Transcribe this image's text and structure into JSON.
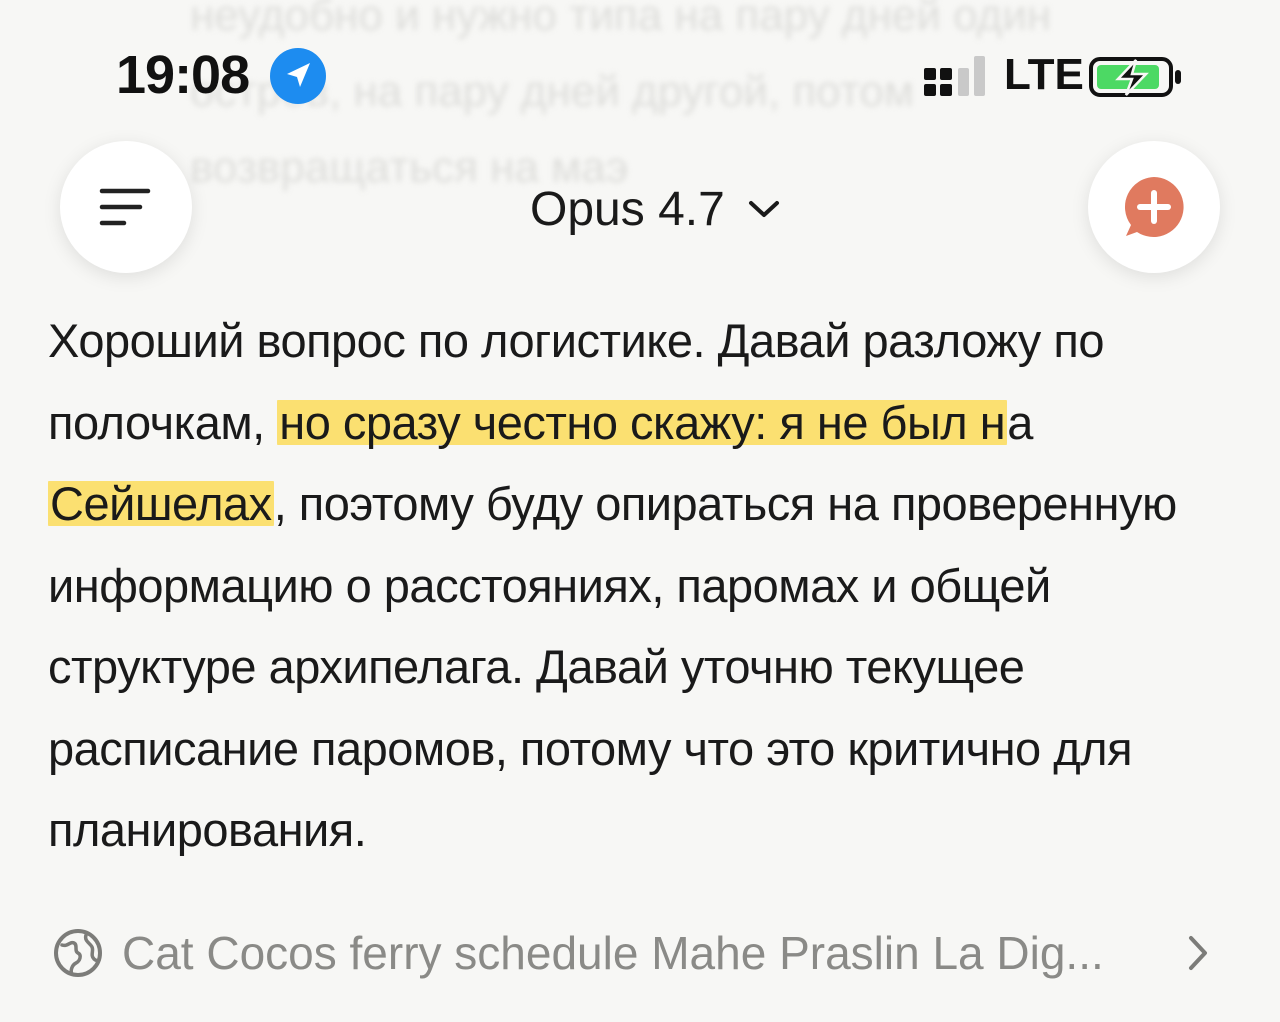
{
  "status_bar": {
    "time": "19:08",
    "network": "LTE"
  },
  "header": {
    "model_label": "Opus 4.7"
  },
  "message": {
    "part1": "Хороший вопрос по логистике. Давай разложу по полочкам, ",
    "highlight1": "но сразу честно скажу: я не был н",
    "part2": "а ",
    "highlight2": "Сейшелах",
    "part3": ", поэтому буду опираться на проверенную информацию о расстояниях, паромах и общей структуре архипелага. Давай уточню текущее расписание паромов, потому что это критично для планирования."
  },
  "search": {
    "query": "Cat Cocos ferry schedule Mahe Praslin La Dig..."
  },
  "colors": {
    "accent_orange": "#e07a5f",
    "highlight_yellow": "#fcda4c",
    "location_blue": "#1d8cf0",
    "battery_green": "#4cd964"
  }
}
